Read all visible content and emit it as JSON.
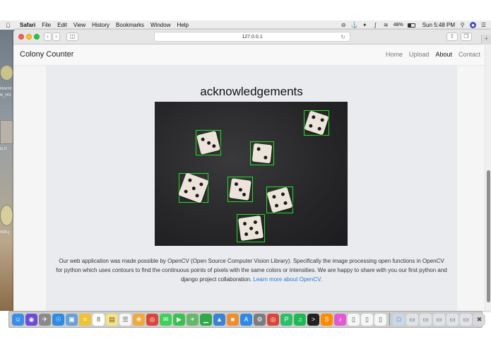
{
  "menubar": {
    "app_name": "Safari",
    "items": [
      "File",
      "Edit",
      "View",
      "History",
      "Bookmarks",
      "Window",
      "Help"
    ],
    "battery": "48%",
    "clock": "Sun 5:48 PM"
  },
  "desktop": {
    "thumb_labels": [
      "RAFR",
      "B_RS",
      "D7I",
      "439.j"
    ]
  },
  "browser": {
    "url": "127.0.0.1"
  },
  "site": {
    "brand": "Colony Counter",
    "nav": [
      "Home",
      "Upload",
      "About",
      "Contact"
    ],
    "active_nav": "About",
    "heading": "acknowledgements",
    "caption_text": "Our web application was made possible by OpenCV (Open Source Computer Vision Library). Specifically the image processing open functions in OpenCV for python which uses contours to find the continuous points of pixels with the same colors or intensities. We are happy to share with you our first python and django project collaboration. ",
    "caption_link": "Learn more about OpenCV."
  },
  "colors": {
    "link": "#2a7ad8",
    "detection_box": "#1ee21e",
    "close": "#fc5f57",
    "minimize": "#fdbb2e",
    "zoom": "#27c840"
  },
  "dice": [
    {
      "face": 4
    },
    {
      "face": 3
    },
    {
      "face": 2
    },
    {
      "face": 5
    },
    {
      "face": 3
    },
    {
      "face": 4
    },
    {
      "face": 5
    }
  ],
  "dock_icons": [
    "finder-icon",
    "siri-icon",
    "launchpad-icon",
    "safari-icon",
    "preview-icon",
    "notes-icon",
    "calendar-icon",
    "stickies-icon",
    "reminders-icon",
    "photos-icon",
    "chrome-icon",
    "messages-icon",
    "facetime-icon",
    "maps-icon",
    "numbers-icon",
    "keynote-icon",
    "ibooks-icon",
    "appstore-icon",
    "sysprefs-icon",
    "chrome-icon",
    "pycharm-icon",
    "spotify-icon",
    "terminal-icon",
    "sublime-icon",
    "itunes-icon",
    "document-icon",
    "document-icon",
    "document-icon",
    "folder-icon",
    "screenshot-icon",
    "screenshot-icon",
    "screenshot-icon",
    "screenshot-icon",
    "screenshot-icon",
    "trash-icon"
  ]
}
